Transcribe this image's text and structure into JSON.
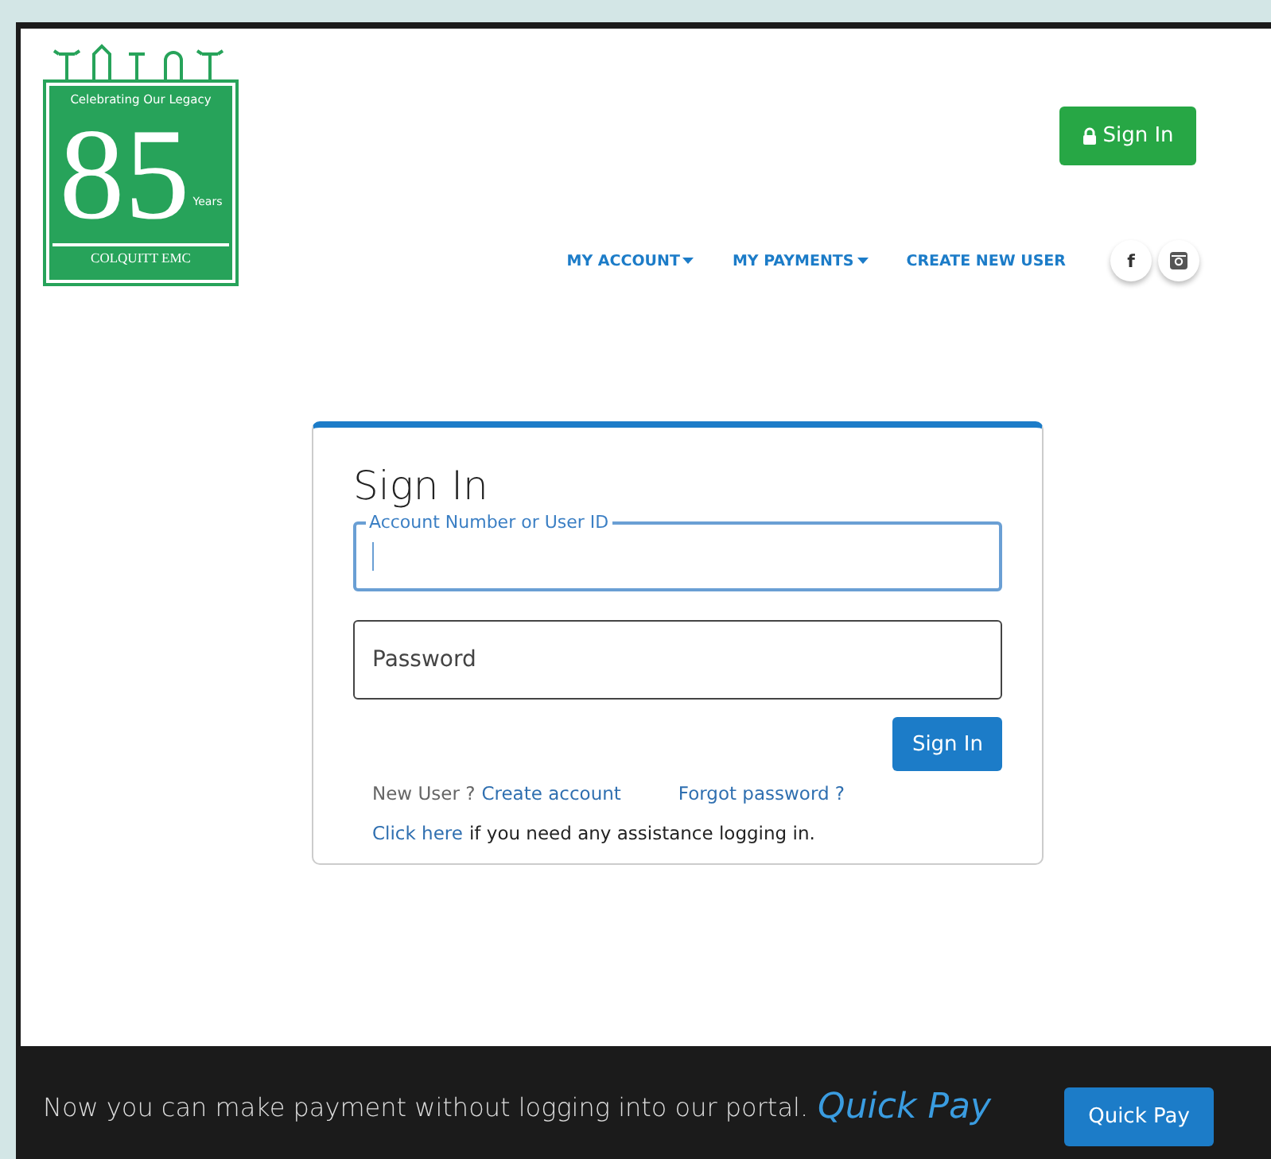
{
  "logo": {
    "tagline": "Celebrating Our Legacy",
    "number": "85",
    "unit": "Years",
    "name": "COLQUITT EMC"
  },
  "header_button": {
    "label": "Sign In"
  },
  "nav": [
    {
      "label": "MY ACCOUNT",
      "dropdown": true
    },
    {
      "label": "MY PAYMENTS",
      "dropdown": true
    },
    {
      "label": "CREATE NEW USER",
      "dropdown": false
    }
  ],
  "social": [
    {
      "kind": "facebook",
      "label": "f"
    },
    {
      "kind": "instagram"
    }
  ],
  "sign_in": {
    "title": "Sign In",
    "account_field": {
      "label": "Account Number or User ID",
      "focused": true
    },
    "password_field": {
      "placeholder": "Password"
    },
    "button": "Sign In",
    "new_user": "New User ?",
    "create_link": "Create account",
    "forgot_link": "Forgot password ?",
    "help_link": "Click here",
    "help_text": "if you need any assistance logging in."
  },
  "footer": {
    "text": "Now you can make payment without logging into our portal.",
    "highlight": "Quick Pay",
    "button": "Quick Pay"
  }
}
